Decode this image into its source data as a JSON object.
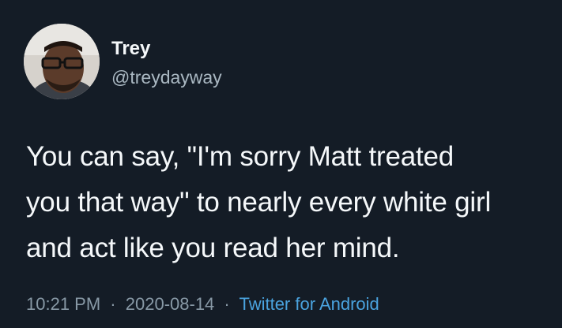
{
  "tweet": {
    "author": {
      "name": "Trey",
      "handle": "@treydayway",
      "avatar_icon": "profile-photo"
    },
    "text_lines": [
      "You can say, \"I'm sorry Matt treated",
      "you that way\" to nearly every white girl",
      "and act like you read her mind."
    ],
    "time": "10:21 PM",
    "date": "2020-08-14",
    "separator": "·",
    "source": "Twitter for Android"
  },
  "colors": {
    "background": "#141c26",
    "text": "#f5f8fa",
    "muted": "#8899a6",
    "link": "#4aa3df"
  }
}
